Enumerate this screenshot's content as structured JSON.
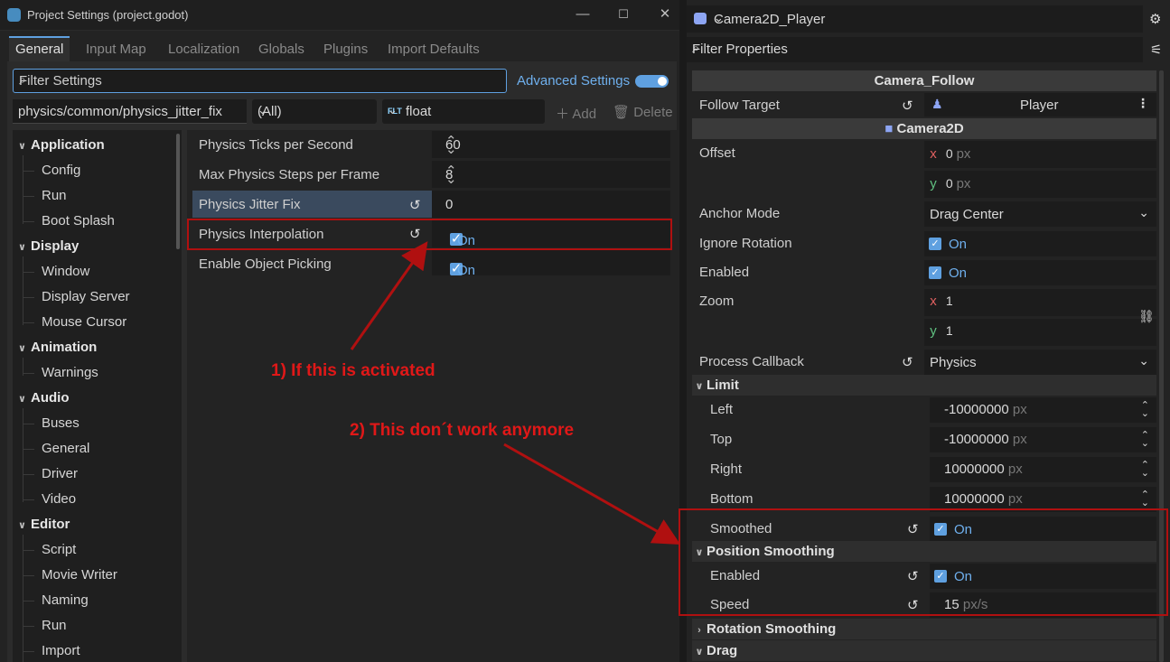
{
  "window": {
    "title": "Project Settings (project.godot)",
    "minimize": "—",
    "maximize": "☐",
    "close": "✕"
  },
  "tabs": [
    "General",
    "Input Map",
    "Localization",
    "Globals",
    "Plugins",
    "Import Defaults"
  ],
  "filter": {
    "placeholder": "Filter Settings",
    "advanced_label": "Advanced Settings"
  },
  "property_path": "physics/common/physics_jitter_fix",
  "type_filter": "(All)",
  "type_select": {
    "badge": "FLT",
    "label": "float"
  },
  "add_label": "Add",
  "delete_label": "Delete",
  "tree": [
    {
      "section": "Application",
      "items": [
        "Config",
        "Run",
        "Boot Splash"
      ]
    },
    {
      "section": "Display",
      "items": [
        "Window",
        "Display Server",
        "Mouse Cursor"
      ]
    },
    {
      "section": "Animation",
      "items": [
        "Warnings"
      ]
    },
    {
      "section": "Audio",
      "items": [
        "Buses",
        "General",
        "Driver",
        "Video"
      ]
    },
    {
      "section": "Editor",
      "items": [
        "Script",
        "Movie Writer",
        "Naming",
        "Run",
        "Import"
      ]
    }
  ],
  "settings": [
    {
      "label": "Physics Ticks per Second",
      "value": "60"
    },
    {
      "label": "Max Physics Steps per Frame",
      "value": "8"
    },
    {
      "label": "Physics Jitter Fix",
      "value": "0"
    },
    {
      "label": "Physics Interpolation",
      "value": "On"
    },
    {
      "label": "Enable Object Picking",
      "value": "On"
    }
  ],
  "annotations": {
    "first": "1) If this is activated",
    "second": "2) This don´t work anymore"
  },
  "inspector": {
    "node_name": "Camera2D_Player",
    "filter_placeholder": "Filter Properties",
    "category_script": "Camera_Follow",
    "follow_target_label": "Follow Target",
    "follow_target_value": "Player",
    "category_node": "Camera2D",
    "offset_label": "Offset",
    "offset_x": "0",
    "offset_y": "0",
    "px": "px",
    "anchor_label": "Anchor Mode",
    "anchor_value": "Drag Center",
    "ignore_rotation_label": "Ignore Rotation",
    "enabled_label": "Enabled",
    "zoom_label": "Zoom",
    "zoom_x": "1",
    "zoom_y": "1",
    "process_label": "Process Callback",
    "process_value": "Physics",
    "on": "On",
    "limit_group": "Limit",
    "limit_left_label": "Left",
    "limit_left": "-10000000",
    "limit_top_label": "Top",
    "limit_top": "-10000000",
    "limit_right_label": "Right",
    "limit_right": "10000000",
    "limit_bottom_label": "Bottom",
    "limit_bottom": "10000000",
    "smoothed_label": "Smoothed",
    "pos_smoothing_group": "Position Smoothing",
    "ps_enabled_label": "Enabled",
    "ps_speed_label": "Speed",
    "ps_speed": "15",
    "pxs": "px/s",
    "rot_smoothing_group": "Rotation Smoothing",
    "drag_group": "Drag",
    "x": "x",
    "y": "y"
  },
  "colors": {
    "accent": "#5fa0e0",
    "annotation": "#e01818",
    "x_axis": "#e06060",
    "y_axis": "#60c080"
  }
}
